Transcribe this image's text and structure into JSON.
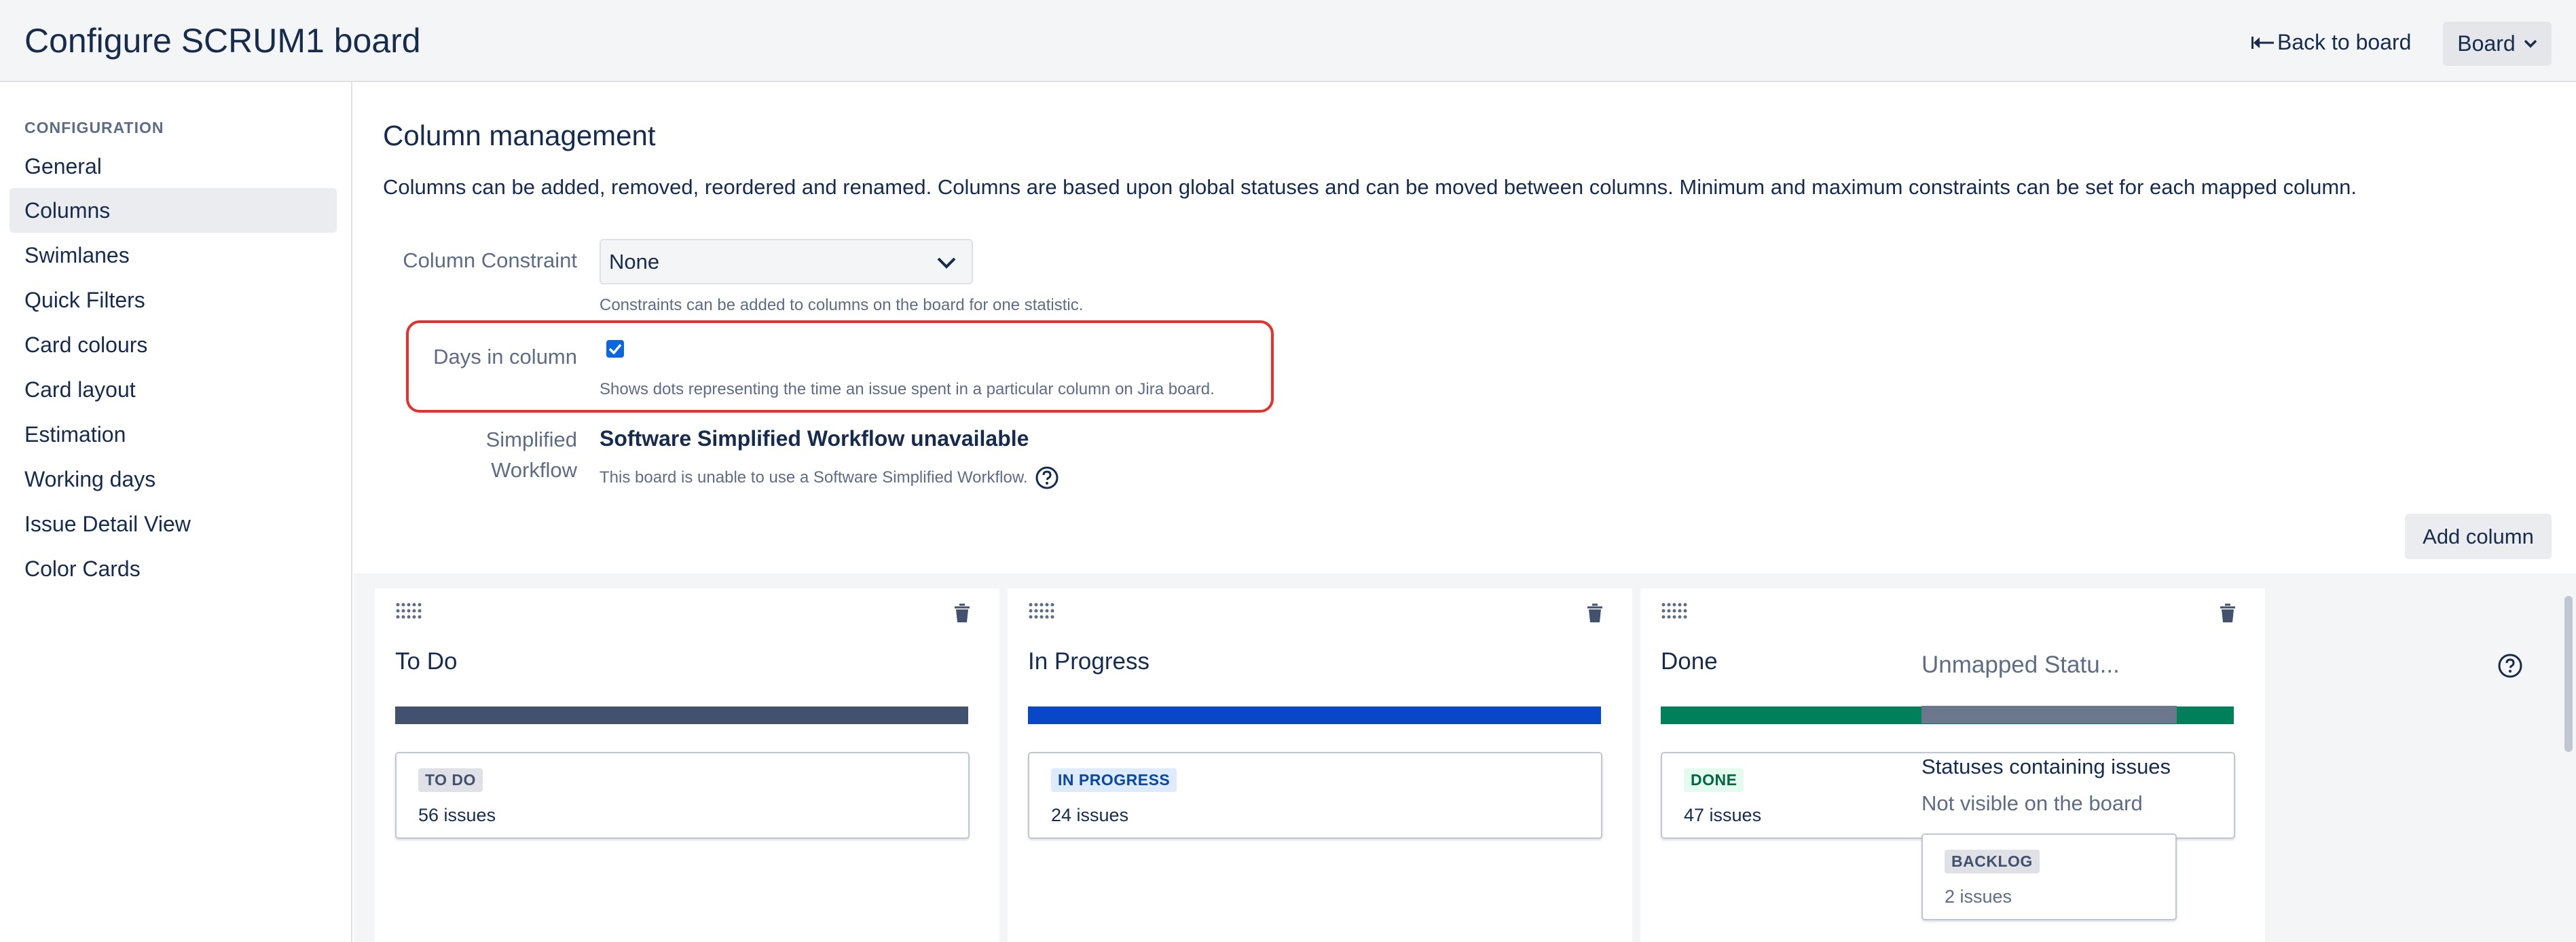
{
  "header": {
    "title": "Configure SCRUM1 board",
    "back_link": "Back to board",
    "board_button": "Board"
  },
  "sidebar": {
    "heading": "CONFIGURATION",
    "items": [
      {
        "label": "General",
        "active": false
      },
      {
        "label": "Columns",
        "active": true
      },
      {
        "label": "Swimlanes",
        "active": false
      },
      {
        "label": "Quick Filters",
        "active": false
      },
      {
        "label": "Card colours",
        "active": false
      },
      {
        "label": "Card layout",
        "active": false
      },
      {
        "label": "Estimation",
        "active": false
      },
      {
        "label": "Working days",
        "active": false
      },
      {
        "label": "Issue Detail View",
        "active": false
      },
      {
        "label": "Color Cards",
        "active": false
      }
    ]
  },
  "main": {
    "title": "Column management",
    "description": "Columns can be added, removed, reordered and renamed. Columns are based upon global statuses and can be moved between columns. Minimum and maximum constraints can be set for each mapped column.",
    "constraint": {
      "label": "Column Constraint",
      "value": "None",
      "help": "Constraints can be added to columns on the board for one statistic."
    },
    "days_in_column": {
      "label": "Days in column",
      "checked": true,
      "help": "Shows dots representing the time an issue spent in a particular column on Jira board."
    },
    "workflow": {
      "label_line1": "Simplified",
      "label_line2": "Workflow",
      "title": "Software Simplified Workflow unavailable",
      "help": "This board is unable to use a Software Simplified Workflow."
    },
    "add_column_label": "Add column"
  },
  "columns": [
    {
      "name": "To Do",
      "bar_color": "#42526e",
      "status": "TO DO",
      "status_bg": "#dfe1e6",
      "status_fg": "#42526e",
      "issues": "56 issues"
    },
    {
      "name": "In Progress",
      "bar_color": "#0747c8",
      "status": "IN PROGRESS",
      "status_bg": "#deebff",
      "status_fg": "#0747a6",
      "issues": "24 issues"
    },
    {
      "name": "Done",
      "bar_color": "#00805a",
      "status": "DONE",
      "status_bg": "#e3fcef",
      "status_fg": "#006644",
      "issues": "47 issues"
    }
  ],
  "unmapped": {
    "title": "Unmapped Statu...",
    "subtitle": "Statuses containing issues",
    "note": "Not visible on the board",
    "status": "BACKLOG",
    "issues": "2 issues"
  },
  "icons": {
    "back": "arrow-left-icon",
    "board": "chevron-down-icon",
    "select": "chevron-down-icon",
    "checkbox": "checkmark-icon",
    "help": "question-circle-icon",
    "drag": "drag-handle-icon",
    "delete": "trash-icon"
  },
  "colors": {
    "accent": "#0b66e4",
    "highlight": "#e5312a"
  }
}
